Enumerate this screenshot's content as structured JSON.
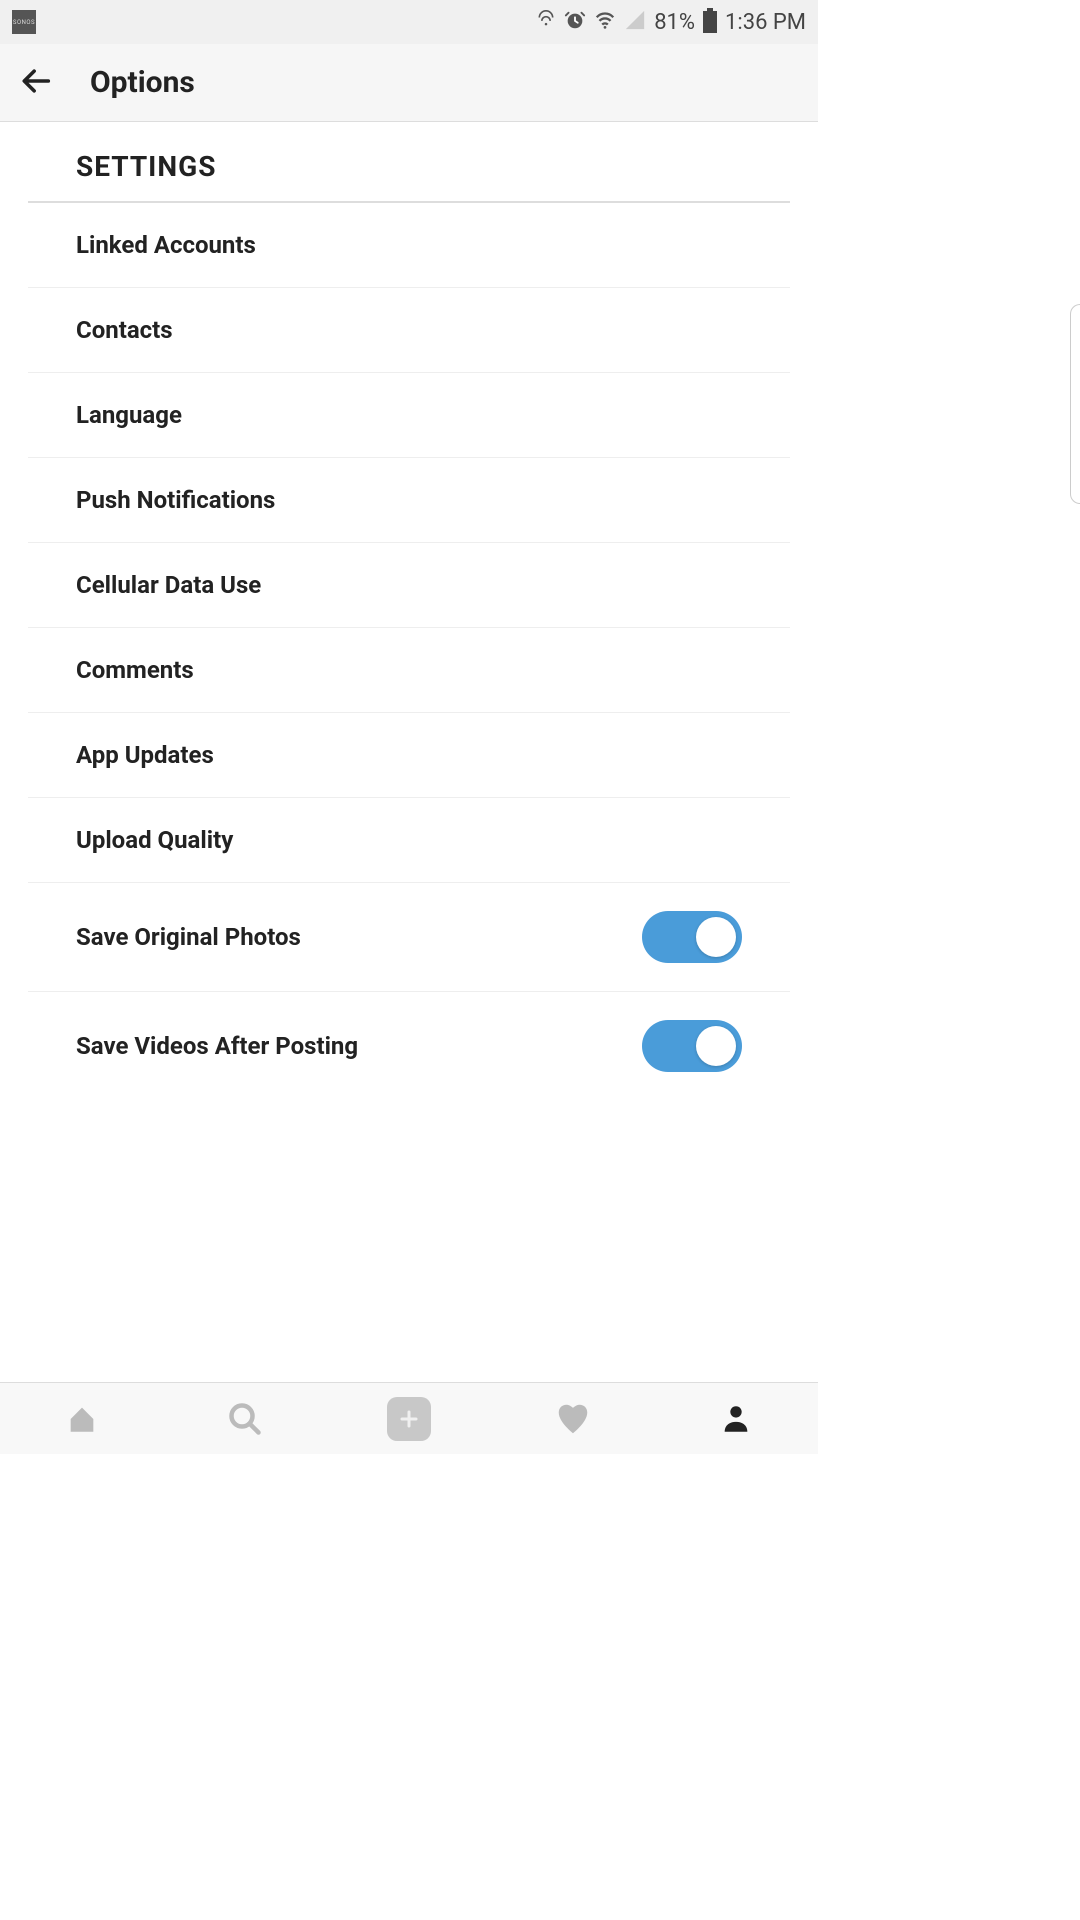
{
  "status": {
    "app_label": "SONOS",
    "battery_pct": "81%",
    "time": "1:36 PM"
  },
  "header": {
    "title": "Options"
  },
  "section": {
    "title": "SETTINGS"
  },
  "items": [
    {
      "label": "Linked Accounts",
      "toggle": null
    },
    {
      "label": "Contacts",
      "toggle": null
    },
    {
      "label": "Language",
      "toggle": null
    },
    {
      "label": "Push Notifications",
      "toggle": null
    },
    {
      "label": "Cellular Data Use",
      "toggle": null
    },
    {
      "label": "Comments",
      "toggle": null
    },
    {
      "label": "App Updates",
      "toggle": null
    },
    {
      "label": "Upload Quality",
      "toggle": null
    },
    {
      "label": "Save Original Photos",
      "toggle": true
    },
    {
      "label": "Save Videos After Posting",
      "toggle": true
    }
  ],
  "colors": {
    "toggle_on": "#4a9cd9"
  }
}
